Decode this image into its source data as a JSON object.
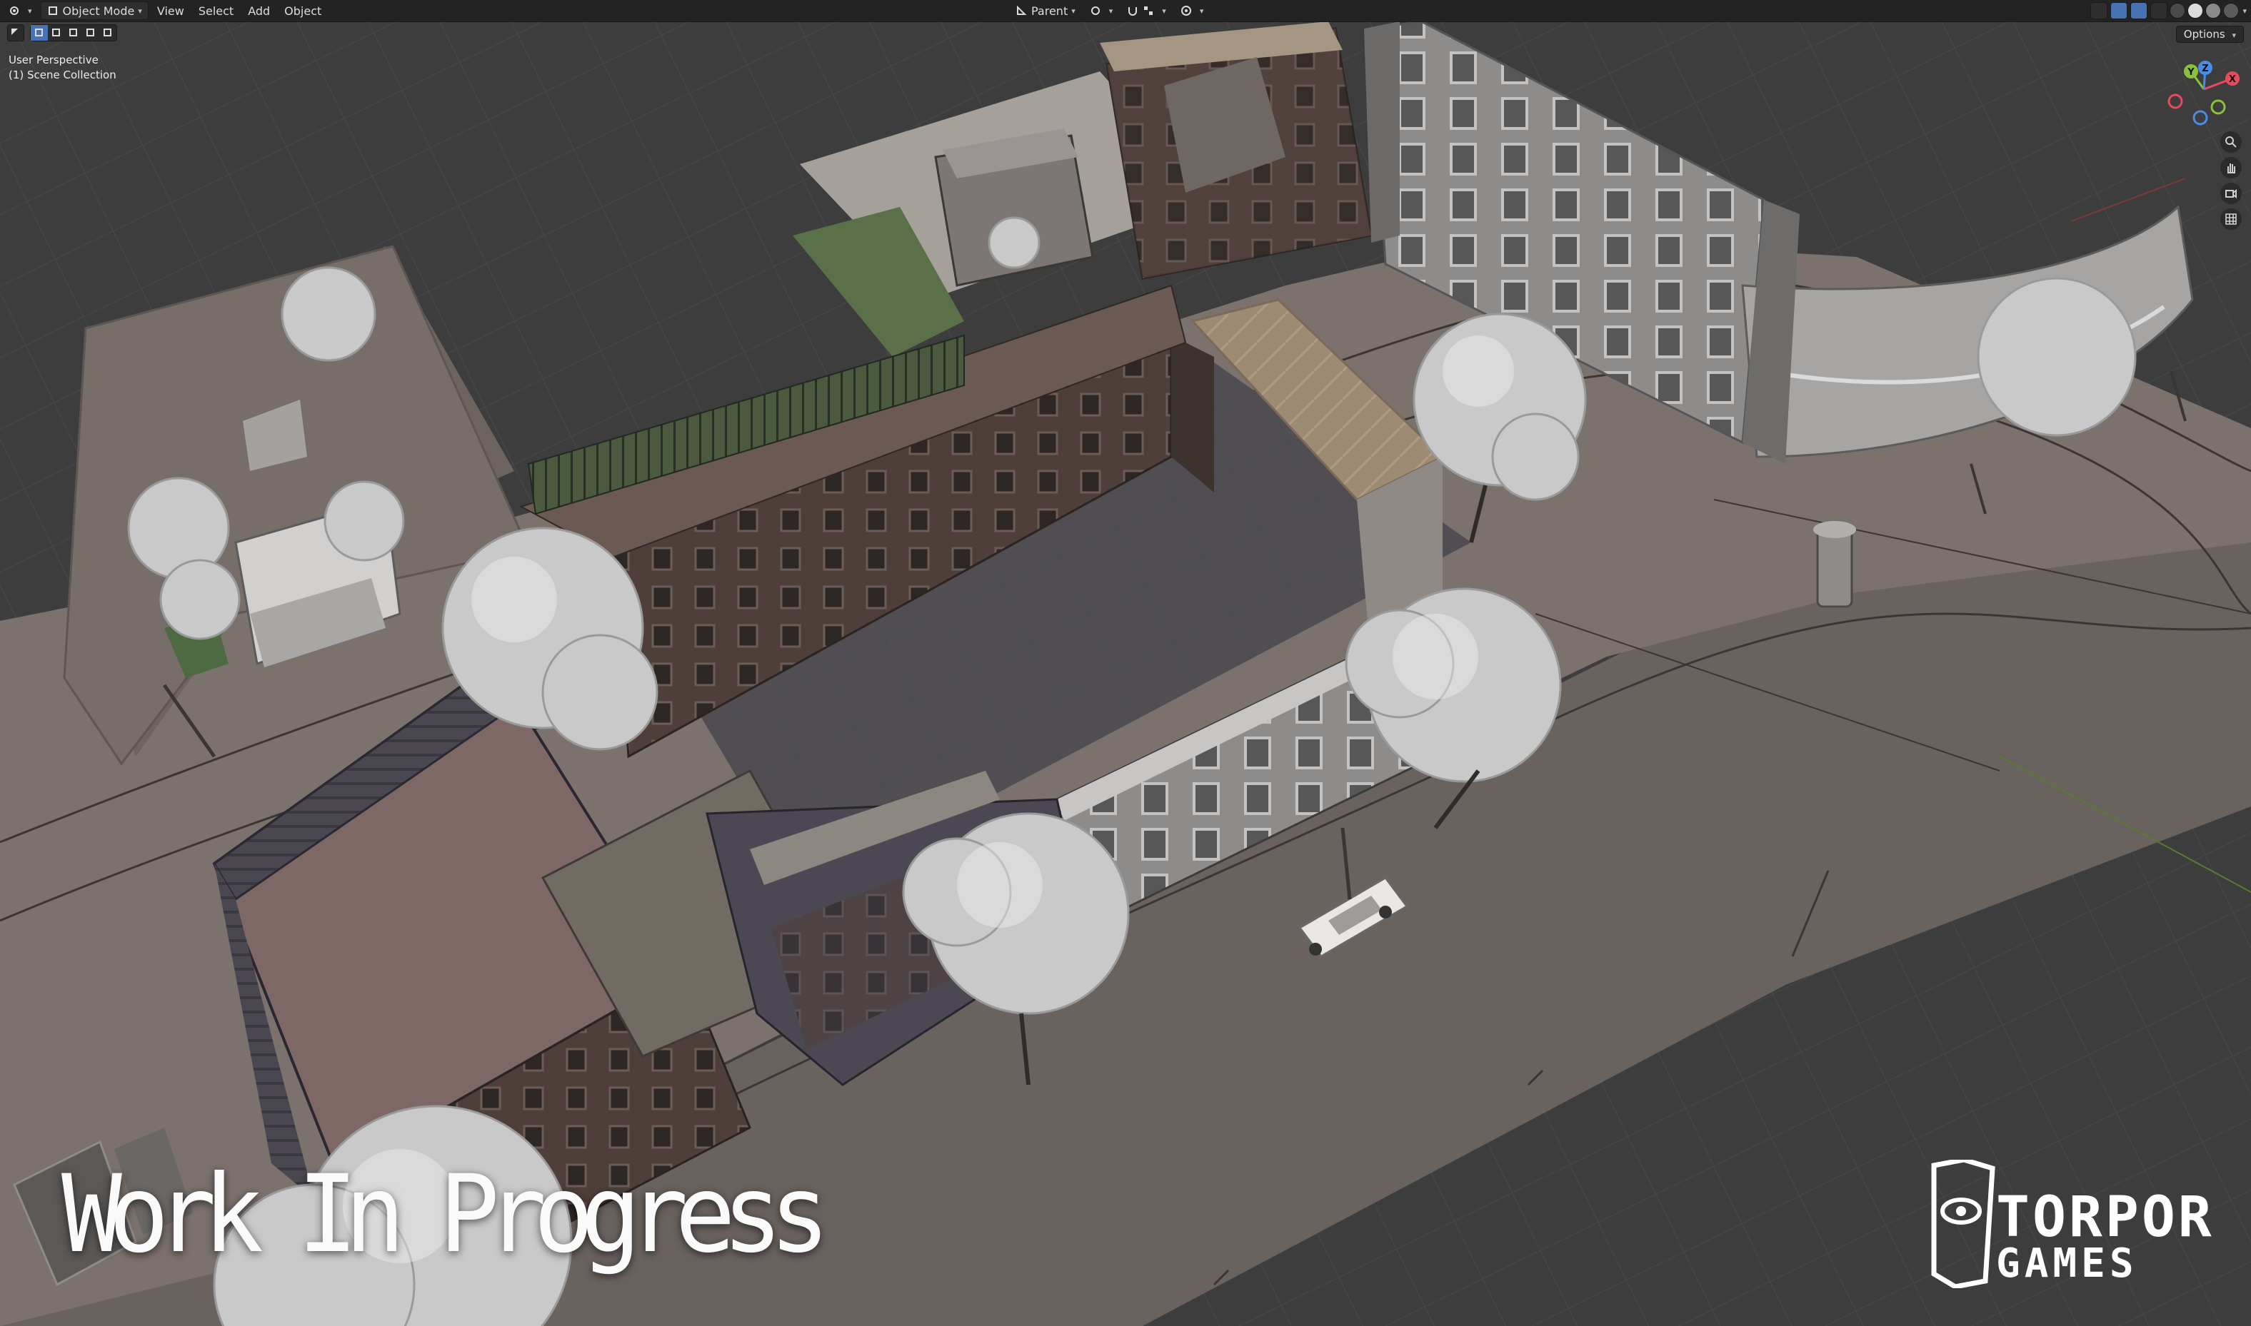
{
  "header": {
    "mode": "Object Mode",
    "menu": [
      "View",
      "Select",
      "Add",
      "Object"
    ],
    "pivot": "Parent"
  },
  "viewport": {
    "perspective": "User Perspective",
    "collection": "(1) Scene Collection",
    "options": "Options"
  },
  "gizmo": {
    "x": "X",
    "y": "Y",
    "z": "Z"
  },
  "overlay": {
    "watermark": "Work In Progress",
    "logo_line1": "TORPOR",
    "logo_line2": "GAMES"
  },
  "colors": {
    "header_bg": "#232323",
    "viewport_bg": "#3d3d3d",
    "active_blue": "#4772b3",
    "axis_x": "#e84a5f",
    "axis_y": "#8ac33a",
    "axis_z": "#4b8ce8"
  }
}
